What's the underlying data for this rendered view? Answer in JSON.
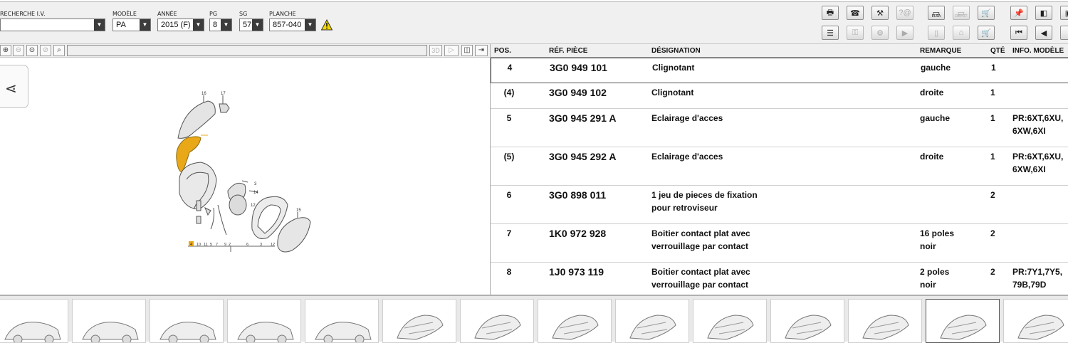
{
  "filters": {
    "search_iv": {
      "label": "RECHERCHE I.V.",
      "value": ""
    },
    "modele": {
      "label": "MODÈLE",
      "value": "PA"
    },
    "annee": {
      "label": "ANNÉE",
      "value": "2015 (F)"
    },
    "pg": {
      "label": "PG",
      "value": "8"
    },
    "sg": {
      "label": "SG",
      "value": "57"
    },
    "planche": {
      "label": "PLANCHE",
      "value": "857-040"
    }
  },
  "toolbar": {
    "elsa_label": "ELSA",
    "depot_label": "DEPOT"
  },
  "view_toolbar": {
    "btn_3d_label": "3D"
  },
  "table": {
    "headers": {
      "pos": "POS.",
      "ref": "RÉF. PIÈCE",
      "designation": "DÉSIGNATION",
      "remarque": "REMARQUE",
      "qte": "QTÉ",
      "info": "INFO. MODÈLE"
    },
    "rows": [
      {
        "pos": "4",
        "ref": "3G0 949 101",
        "designation": [
          "Clignotant"
        ],
        "remarque": [
          "gauche"
        ],
        "qte": "1",
        "info": [],
        "selected": true
      },
      {
        "pos": "(4)",
        "ref": "3G0 949 102",
        "designation": [
          "Clignotant"
        ],
        "remarque": [
          "droite"
        ],
        "qte": "1",
        "info": []
      },
      {
        "pos": "5",
        "ref": "3G0 945 291 A",
        "designation": [
          "Eclairage d'acces"
        ],
        "remarque": [
          "gauche"
        ],
        "qte": "1",
        "info": [
          "PR:6XT,6XU,",
          "6XW,6XI"
        ]
      },
      {
        "pos": "(5)",
        "ref": "3G0 945 292 A",
        "designation": [
          "Eclairage d'acces"
        ],
        "remarque": [
          "droite"
        ],
        "qte": "1",
        "info": [
          "PR:6XT,6XU,",
          "6XW,6XI"
        ]
      },
      {
        "pos": "6",
        "ref": "3G0 898 011",
        "designation": [
          "1 jeu de pieces de fixation",
          "pour retroviseur"
        ],
        "remarque": [],
        "qte": "2",
        "info": []
      },
      {
        "pos": "7",
        "ref": "1K0 972 928",
        "designation": [
          "Boitier contact plat avec",
          "verrouillage par contact"
        ],
        "remarque": [
          "16 poles",
          "noir"
        ],
        "qte": "2",
        "info": []
      },
      {
        "pos": "8",
        "ref": "1J0 973 119",
        "designation": [
          "Boitier contact plat avec",
          "verrouillage par contact"
        ],
        "remarque": [
          "2 poles",
          "noir"
        ],
        "qte": "2",
        "info": [
          "PR:7Y1,7Y5,",
          "79B,79D"
        ]
      }
    ]
  },
  "diagram": {
    "callouts_top": [
      "16",
      "17"
    ],
    "callouts_bottom": [
      "4",
      "10",
      "11",
      "5",
      "7",
      "9",
      "2",
      "6",
      "3",
      "12"
    ],
    "callout_right": [
      "15",
      "14",
      "3",
      "12"
    ],
    "highlight_color": "#e8a817"
  },
  "thumbnails": {
    "count": 14,
    "selected_index": 12
  },
  "colors": {
    "warning": "#f2d600",
    "highlight": "#e8a817"
  }
}
